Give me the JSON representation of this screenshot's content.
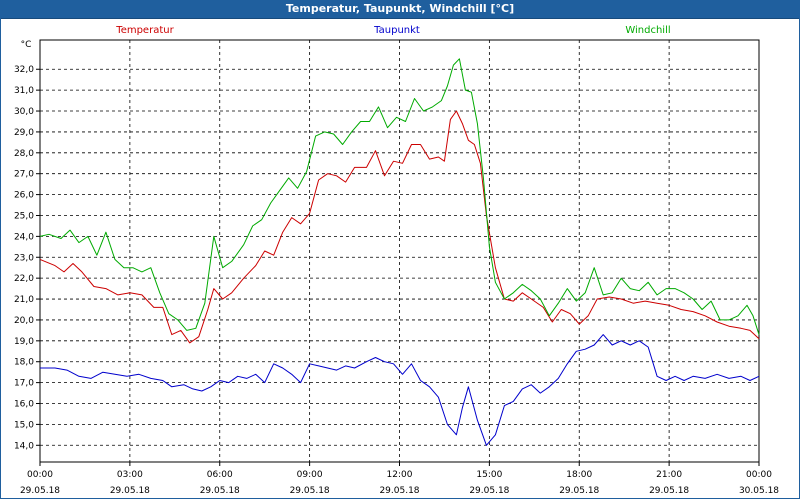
{
  "window": {
    "title": "Temperatur, Taupunkt, Windchill [°C]"
  },
  "chart_data": {
    "type": "line",
    "title": "Temperatur, Taupunkt, Windchill [°C]",
    "ylabel": "°C",
    "xlabel": "",
    "ylim": [
      13.2,
      33.4
    ],
    "yticks": [
      "14,0",
      "15,0",
      "16,0",
      "17,0",
      "18,0",
      "19,0",
      "20,0",
      "21,0",
      "22,0",
      "23,0",
      "24,0",
      "25,0",
      "26,0",
      "27,0",
      "28,0",
      "29,0",
      "30,0",
      "31,0",
      "32,0"
    ],
    "ytick_values": [
      14,
      15,
      16,
      17,
      18,
      19,
      20,
      21,
      22,
      23,
      24,
      25,
      26,
      27,
      28,
      29,
      30,
      31,
      32
    ],
    "xlim": [
      0,
      24
    ],
    "xticks": [
      {
        "x": 0,
        "time": "00:00",
        "date": "29.05.18"
      },
      {
        "x": 3,
        "time": "03:00",
        "date": "29.05.18"
      },
      {
        "x": 6,
        "time": "06:00",
        "date": "29.05.18"
      },
      {
        "x": 9,
        "time": "09:00",
        "date": "29.05.18"
      },
      {
        "x": 12,
        "time": "12:00",
        "date": "29.05.18"
      },
      {
        "x": 15,
        "time": "15:00",
        "date": "29.05.18"
      },
      {
        "x": 18,
        "time": "18:00",
        "date": "29.05.18"
      },
      {
        "x": 21,
        "time": "21:00",
        "date": "29.05.18"
      },
      {
        "x": 24,
        "time": "00:00",
        "date": "30.05.18"
      }
    ],
    "grid": true,
    "legend_position": "top",
    "series": [
      {
        "name": "Temperatur",
        "color": "#cc0000",
        "points": [
          [
            0,
            22.9
          ],
          [
            0.5,
            22.6
          ],
          [
            0.8,
            22.3
          ],
          [
            1.1,
            22.7
          ],
          [
            1.4,
            22.3
          ],
          [
            1.8,
            21.6
          ],
          [
            2.2,
            21.5
          ],
          [
            2.6,
            21.2
          ],
          [
            3.0,
            21.3
          ],
          [
            3.4,
            21.2
          ],
          [
            3.8,
            20.6
          ],
          [
            4.1,
            20.6
          ],
          [
            4.4,
            19.3
          ],
          [
            4.7,
            19.5
          ],
          [
            5.0,
            18.9
          ],
          [
            5.3,
            19.2
          ],
          [
            5.6,
            20.5
          ],
          [
            5.8,
            21.5
          ],
          [
            6.1,
            21.0
          ],
          [
            6.4,
            21.3
          ],
          [
            6.8,
            22.0
          ],
          [
            7.2,
            22.6
          ],
          [
            7.5,
            23.3
          ],
          [
            7.8,
            23.1
          ],
          [
            8.1,
            24.2
          ],
          [
            8.4,
            24.9
          ],
          [
            8.7,
            24.6
          ],
          [
            9.0,
            25.1
          ],
          [
            9.3,
            26.7
          ],
          [
            9.6,
            27.0
          ],
          [
            9.9,
            26.9
          ],
          [
            10.2,
            26.6
          ],
          [
            10.5,
            27.3
          ],
          [
            10.9,
            27.3
          ],
          [
            11.2,
            28.1
          ],
          [
            11.5,
            26.9
          ],
          [
            11.8,
            27.6
          ],
          [
            12.1,
            27.5
          ],
          [
            12.4,
            28.4
          ],
          [
            12.7,
            28.4
          ],
          [
            13.0,
            27.7
          ],
          [
            13.3,
            27.8
          ],
          [
            13.5,
            27.6
          ],
          [
            13.7,
            29.6
          ],
          [
            13.9,
            30.0
          ],
          [
            14.1,
            29.4
          ],
          [
            14.3,
            28.6
          ],
          [
            14.5,
            28.4
          ],
          [
            14.7,
            27.5
          ],
          [
            14.9,
            25.0
          ],
          [
            15.2,
            22.5
          ],
          [
            15.5,
            21.0
          ],
          [
            15.8,
            20.9
          ],
          [
            16.1,
            21.3
          ],
          [
            16.4,
            21.0
          ],
          [
            16.8,
            20.6
          ],
          [
            17.1,
            19.9
          ],
          [
            17.4,
            20.5
          ],
          [
            17.7,
            20.3
          ],
          [
            18.0,
            19.8
          ],
          [
            18.3,
            20.2
          ],
          [
            18.6,
            21.0
          ],
          [
            19.0,
            21.1
          ],
          [
            19.4,
            21.0
          ],
          [
            19.8,
            20.8
          ],
          [
            20.2,
            20.9
          ],
          [
            20.6,
            20.8
          ],
          [
            21.0,
            20.7
          ],
          [
            21.4,
            20.5
          ],
          [
            21.8,
            20.4
          ],
          [
            22.2,
            20.2
          ],
          [
            22.6,
            19.9
          ],
          [
            23.0,
            19.7
          ],
          [
            23.4,
            19.6
          ],
          [
            23.7,
            19.5
          ],
          [
            24.0,
            19.1
          ]
        ]
      },
      {
        "name": "Taupunkt",
        "color": "#0000cc",
        "points": [
          [
            0,
            17.7
          ],
          [
            0.5,
            17.7
          ],
          [
            0.9,
            17.6
          ],
          [
            1.3,
            17.3
          ],
          [
            1.7,
            17.2
          ],
          [
            2.1,
            17.5
          ],
          [
            2.5,
            17.4
          ],
          [
            2.9,
            17.3
          ],
          [
            3.3,
            17.4
          ],
          [
            3.7,
            17.2
          ],
          [
            4.1,
            17.1
          ],
          [
            4.4,
            16.8
          ],
          [
            4.8,
            16.9
          ],
          [
            5.1,
            16.7
          ],
          [
            5.4,
            16.6
          ],
          [
            5.7,
            16.8
          ],
          [
            6.0,
            17.1
          ],
          [
            6.3,
            17.0
          ],
          [
            6.6,
            17.3
          ],
          [
            6.9,
            17.2
          ],
          [
            7.2,
            17.4
          ],
          [
            7.5,
            17.0
          ],
          [
            7.8,
            17.9
          ],
          [
            8.1,
            17.7
          ],
          [
            8.4,
            17.4
          ],
          [
            8.7,
            17.0
          ],
          [
            9.0,
            17.9
          ],
          [
            9.3,
            17.8
          ],
          [
            9.6,
            17.7
          ],
          [
            9.9,
            17.6
          ],
          [
            10.2,
            17.8
          ],
          [
            10.5,
            17.7
          ],
          [
            10.9,
            18.0
          ],
          [
            11.2,
            18.2
          ],
          [
            11.5,
            18.0
          ],
          [
            11.8,
            17.9
          ],
          [
            12.1,
            17.4
          ],
          [
            12.4,
            17.9
          ],
          [
            12.7,
            17.1
          ],
          [
            13.0,
            16.8
          ],
          [
            13.3,
            16.3
          ],
          [
            13.6,
            15.0
          ],
          [
            13.9,
            14.5
          ],
          [
            14.1,
            15.8
          ],
          [
            14.3,
            16.8
          ],
          [
            14.6,
            15.2
          ],
          [
            14.9,
            14.0
          ],
          [
            15.2,
            14.5
          ],
          [
            15.5,
            15.9
          ],
          [
            15.8,
            16.1
          ],
          [
            16.1,
            16.7
          ],
          [
            16.4,
            16.9
          ],
          [
            16.7,
            16.5
          ],
          [
            17.0,
            16.8
          ],
          [
            17.3,
            17.2
          ],
          [
            17.6,
            17.9
          ],
          [
            17.9,
            18.5
          ],
          [
            18.2,
            18.6
          ],
          [
            18.5,
            18.8
          ],
          [
            18.8,
            19.3
          ],
          [
            19.1,
            18.8
          ],
          [
            19.4,
            19.0
          ],
          [
            19.7,
            18.8
          ],
          [
            20.0,
            19.0
          ],
          [
            20.3,
            18.7
          ],
          [
            20.6,
            17.3
          ],
          [
            20.9,
            17.1
          ],
          [
            21.2,
            17.3
          ],
          [
            21.5,
            17.1
          ],
          [
            21.8,
            17.3
          ],
          [
            22.2,
            17.2
          ],
          [
            22.6,
            17.4
          ],
          [
            23.0,
            17.2
          ],
          [
            23.4,
            17.3
          ],
          [
            23.7,
            17.1
          ],
          [
            24.0,
            17.3
          ]
        ]
      },
      {
        "name": "Windchill",
        "color": "#00aa00",
        "points": [
          [
            0,
            24.0
          ],
          [
            0.3,
            24.1
          ],
          [
            0.7,
            23.9
          ],
          [
            1.0,
            24.3
          ],
          [
            1.3,
            23.7
          ],
          [
            1.6,
            24.0
          ],
          [
            1.9,
            23.1
          ],
          [
            2.2,
            24.2
          ],
          [
            2.5,
            22.9
          ],
          [
            2.8,
            22.5
          ],
          [
            3.1,
            22.5
          ],
          [
            3.4,
            22.3
          ],
          [
            3.7,
            22.5
          ],
          [
            4.0,
            21.3
          ],
          [
            4.3,
            20.3
          ],
          [
            4.6,
            20.0
          ],
          [
            4.9,
            19.5
          ],
          [
            5.2,
            19.6
          ],
          [
            5.5,
            20.8
          ],
          [
            5.8,
            24.0
          ],
          [
            6.1,
            22.5
          ],
          [
            6.4,
            22.8
          ],
          [
            6.8,
            23.6
          ],
          [
            7.1,
            24.5
          ],
          [
            7.4,
            24.8
          ],
          [
            7.7,
            25.6
          ],
          [
            8.0,
            26.2
          ],
          [
            8.3,
            26.8
          ],
          [
            8.6,
            26.3
          ],
          [
            8.9,
            27.1
          ],
          [
            9.2,
            28.8
          ],
          [
            9.5,
            29.0
          ],
          [
            9.8,
            28.9
          ],
          [
            10.1,
            28.4
          ],
          [
            10.4,
            29.0
          ],
          [
            10.7,
            29.5
          ],
          [
            11.0,
            29.5
          ],
          [
            11.3,
            30.2
          ],
          [
            11.6,
            29.2
          ],
          [
            11.9,
            29.7
          ],
          [
            12.2,
            29.5
          ],
          [
            12.5,
            30.6
          ],
          [
            12.8,
            30.0
          ],
          [
            13.1,
            30.2
          ],
          [
            13.4,
            30.5
          ],
          [
            13.6,
            31.2
          ],
          [
            13.8,
            32.2
          ],
          [
            14.0,
            32.5
          ],
          [
            14.2,
            31.0
          ],
          [
            14.4,
            30.9
          ],
          [
            14.6,
            29.4
          ],
          [
            14.8,
            26.8
          ],
          [
            15.0,
            23.5
          ],
          [
            15.2,
            21.8
          ],
          [
            15.5,
            21.0
          ],
          [
            15.8,
            21.3
          ],
          [
            16.1,
            21.7
          ],
          [
            16.4,
            21.4
          ],
          [
            16.7,
            21.0
          ],
          [
            17.0,
            20.2
          ],
          [
            17.3,
            20.8
          ],
          [
            17.6,
            21.5
          ],
          [
            17.9,
            20.9
          ],
          [
            18.2,
            21.3
          ],
          [
            18.5,
            22.5
          ],
          [
            18.8,
            21.2
          ],
          [
            19.1,
            21.3
          ],
          [
            19.4,
            22.0
          ],
          [
            19.7,
            21.5
          ],
          [
            20.0,
            21.4
          ],
          [
            20.3,
            21.8
          ],
          [
            20.6,
            21.2
          ],
          [
            20.9,
            21.5
          ],
          [
            21.2,
            21.5
          ],
          [
            21.5,
            21.3
          ],
          [
            21.8,
            21.0
          ],
          [
            22.1,
            20.5
          ],
          [
            22.4,
            20.9
          ],
          [
            22.7,
            20.0
          ],
          [
            23.0,
            20.0
          ],
          [
            23.3,
            20.2
          ],
          [
            23.6,
            20.7
          ],
          [
            23.8,
            20.2
          ],
          [
            24.0,
            19.3
          ]
        ]
      }
    ]
  }
}
